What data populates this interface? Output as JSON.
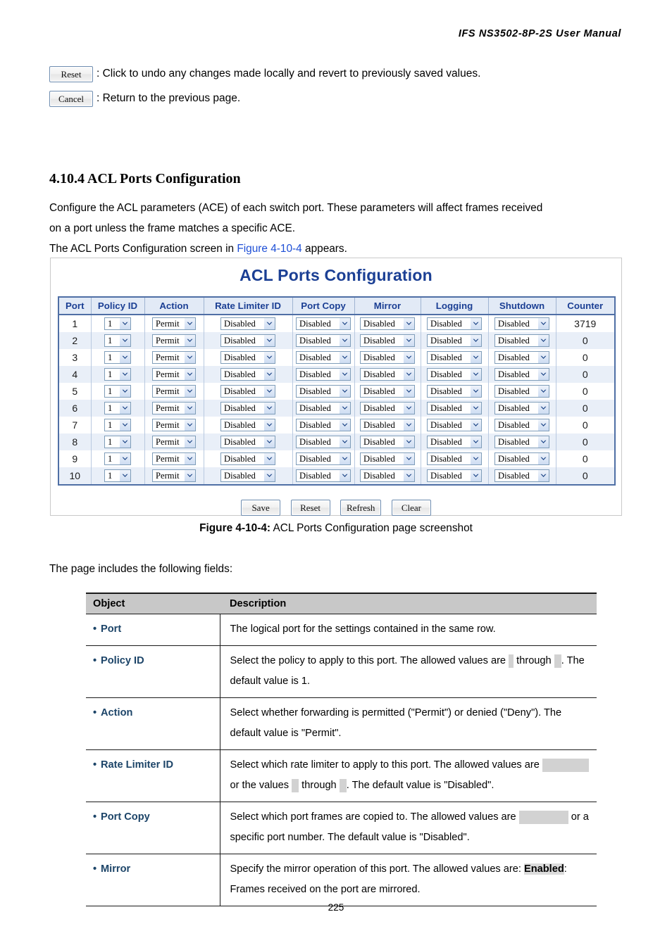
{
  "document": {
    "running_header": "IFS  NS3502-8P-2S  User  Manual",
    "page_number": "225"
  },
  "button_notes": [
    {
      "button_label": "Reset",
      "description": ": Click to undo any changes made locally and revert to previously saved values."
    },
    {
      "button_label": "Cancel",
      "description": ": Return to the previous page."
    }
  ],
  "section": {
    "heading": "4.10.4 ACL Ports Configuration",
    "paragraph_1": "Configure the ACL parameters (ACE) of each switch port. These parameters will affect frames received",
    "paragraph_2": "on a port unless the frame matches a specific ACE.",
    "paragraph_3_pre": "The ACL Ports Configuration screen in ",
    "paragraph_3_link": "Figure 4-10-4",
    "paragraph_3_post": " appears."
  },
  "figure": {
    "ui_title": "ACL Ports Configuration",
    "caption_bold": "Figure 4-10-4:",
    "caption_rest": " ACL Ports Configuration page screenshot",
    "columns": [
      "Port",
      "Policy ID",
      "Action",
      "Rate Limiter ID",
      "Port Copy",
      "Mirror",
      "Logging",
      "Shutdown",
      "Counter"
    ],
    "rows": [
      {
        "port": "1",
        "policy_id": "1",
        "action": "Permit",
        "rate_limiter_id": "Disabled",
        "port_copy": "Disabled",
        "mirror": "Disabled",
        "logging": "Disabled",
        "shutdown": "Disabled",
        "counter": "3719"
      },
      {
        "port": "2",
        "policy_id": "1",
        "action": "Permit",
        "rate_limiter_id": "Disabled",
        "port_copy": "Disabled",
        "mirror": "Disabled",
        "logging": "Disabled",
        "shutdown": "Disabled",
        "counter": "0"
      },
      {
        "port": "3",
        "policy_id": "1",
        "action": "Permit",
        "rate_limiter_id": "Disabled",
        "port_copy": "Disabled",
        "mirror": "Disabled",
        "logging": "Disabled",
        "shutdown": "Disabled",
        "counter": "0"
      },
      {
        "port": "4",
        "policy_id": "1",
        "action": "Permit",
        "rate_limiter_id": "Disabled",
        "port_copy": "Disabled",
        "mirror": "Disabled",
        "logging": "Disabled",
        "shutdown": "Disabled",
        "counter": "0"
      },
      {
        "port": "5",
        "policy_id": "1",
        "action": "Permit",
        "rate_limiter_id": "Disabled",
        "port_copy": "Disabled",
        "mirror": "Disabled",
        "logging": "Disabled",
        "shutdown": "Disabled",
        "counter": "0"
      },
      {
        "port": "6",
        "policy_id": "1",
        "action": "Permit",
        "rate_limiter_id": "Disabled",
        "port_copy": "Disabled",
        "mirror": "Disabled",
        "logging": "Disabled",
        "shutdown": "Disabled",
        "counter": "0"
      },
      {
        "port": "7",
        "policy_id": "1",
        "action": "Permit",
        "rate_limiter_id": "Disabled",
        "port_copy": "Disabled",
        "mirror": "Disabled",
        "logging": "Disabled",
        "shutdown": "Disabled",
        "counter": "0"
      },
      {
        "port": "8",
        "policy_id": "1",
        "action": "Permit",
        "rate_limiter_id": "Disabled",
        "port_copy": "Disabled",
        "mirror": "Disabled",
        "logging": "Disabled",
        "shutdown": "Disabled",
        "counter": "0"
      },
      {
        "port": "9",
        "policy_id": "1",
        "action": "Permit",
        "rate_limiter_id": "Disabled",
        "port_copy": "Disabled",
        "mirror": "Disabled",
        "logging": "Disabled",
        "shutdown": "Disabled",
        "counter": "0"
      },
      {
        "port": "10",
        "policy_id": "1",
        "action": "Permit",
        "rate_limiter_id": "Disabled",
        "port_copy": "Disabled",
        "mirror": "Disabled",
        "logging": "Disabled",
        "shutdown": "Disabled",
        "counter": "0"
      }
    ],
    "action_buttons": [
      "Save",
      "Reset",
      "Refresh",
      "Clear"
    ],
    "colors": {
      "title": "#1b3f94",
      "header_bg": "#e2eaf6",
      "header_text": "#1b3f94",
      "table_border": "#4f6fa5",
      "alt_row_bg": "#e9eff8"
    }
  },
  "fields_intro": "The page includes the following fields:",
  "fields_table": {
    "headers": {
      "object": "Object",
      "description": "Description"
    },
    "rows": [
      {
        "object": "Port",
        "desc_parts": [
          {
            "t": "text",
            "v": "The logical port for the settings contained in the same row."
          }
        ]
      },
      {
        "object": "Policy ID",
        "desc_parts": [
          {
            "t": "text",
            "v": "Select the policy to apply to this port. The allowed values are "
          },
          {
            "t": "blank",
            "size": "xs"
          },
          {
            "t": "text",
            "v": " through "
          },
          {
            "t": "blank",
            "size": "sm"
          },
          {
            "t": "text",
            "v": ". The default value is 1."
          }
        ]
      },
      {
        "object": "Action",
        "desc_parts": [
          {
            "t": "text",
            "v": "Select whether forwarding is permitted (\"Permit\") or denied (\"Deny\"). The default value is \"Permit\"."
          }
        ]
      },
      {
        "object": "Rate Limiter ID",
        "desc_parts": [
          {
            "t": "text",
            "v": "Select which rate limiter to apply to this port. The allowed values are "
          },
          {
            "t": "blank",
            "size": "md"
          },
          {
            "t": "text",
            "v": " or the values "
          },
          {
            "t": "blank",
            "size": "sm"
          },
          {
            "t": "text",
            "v": " through "
          },
          {
            "t": "blank",
            "size": "sm"
          },
          {
            "t": "text",
            "v": ". The default value is \"Disabled\"."
          }
        ]
      },
      {
        "object": "Port Copy",
        "desc_parts": [
          {
            "t": "text",
            "v": "Select which port frames are copied to. The allowed values are "
          },
          {
            "t": "blank",
            "size": "lg"
          },
          {
            "t": "text",
            "v": " or a specific port number. The default value is \"Disabled\"."
          }
        ]
      },
      {
        "object": "Mirror",
        "desc_parts": [
          {
            "t": "text",
            "v": "Specify the mirror operation of this port. The allowed values are: "
          },
          {
            "t": "hl",
            "v": "Enabled"
          },
          {
            "t": "text",
            "v": ": Frames received on the port are mirrored."
          }
        ]
      }
    ]
  }
}
